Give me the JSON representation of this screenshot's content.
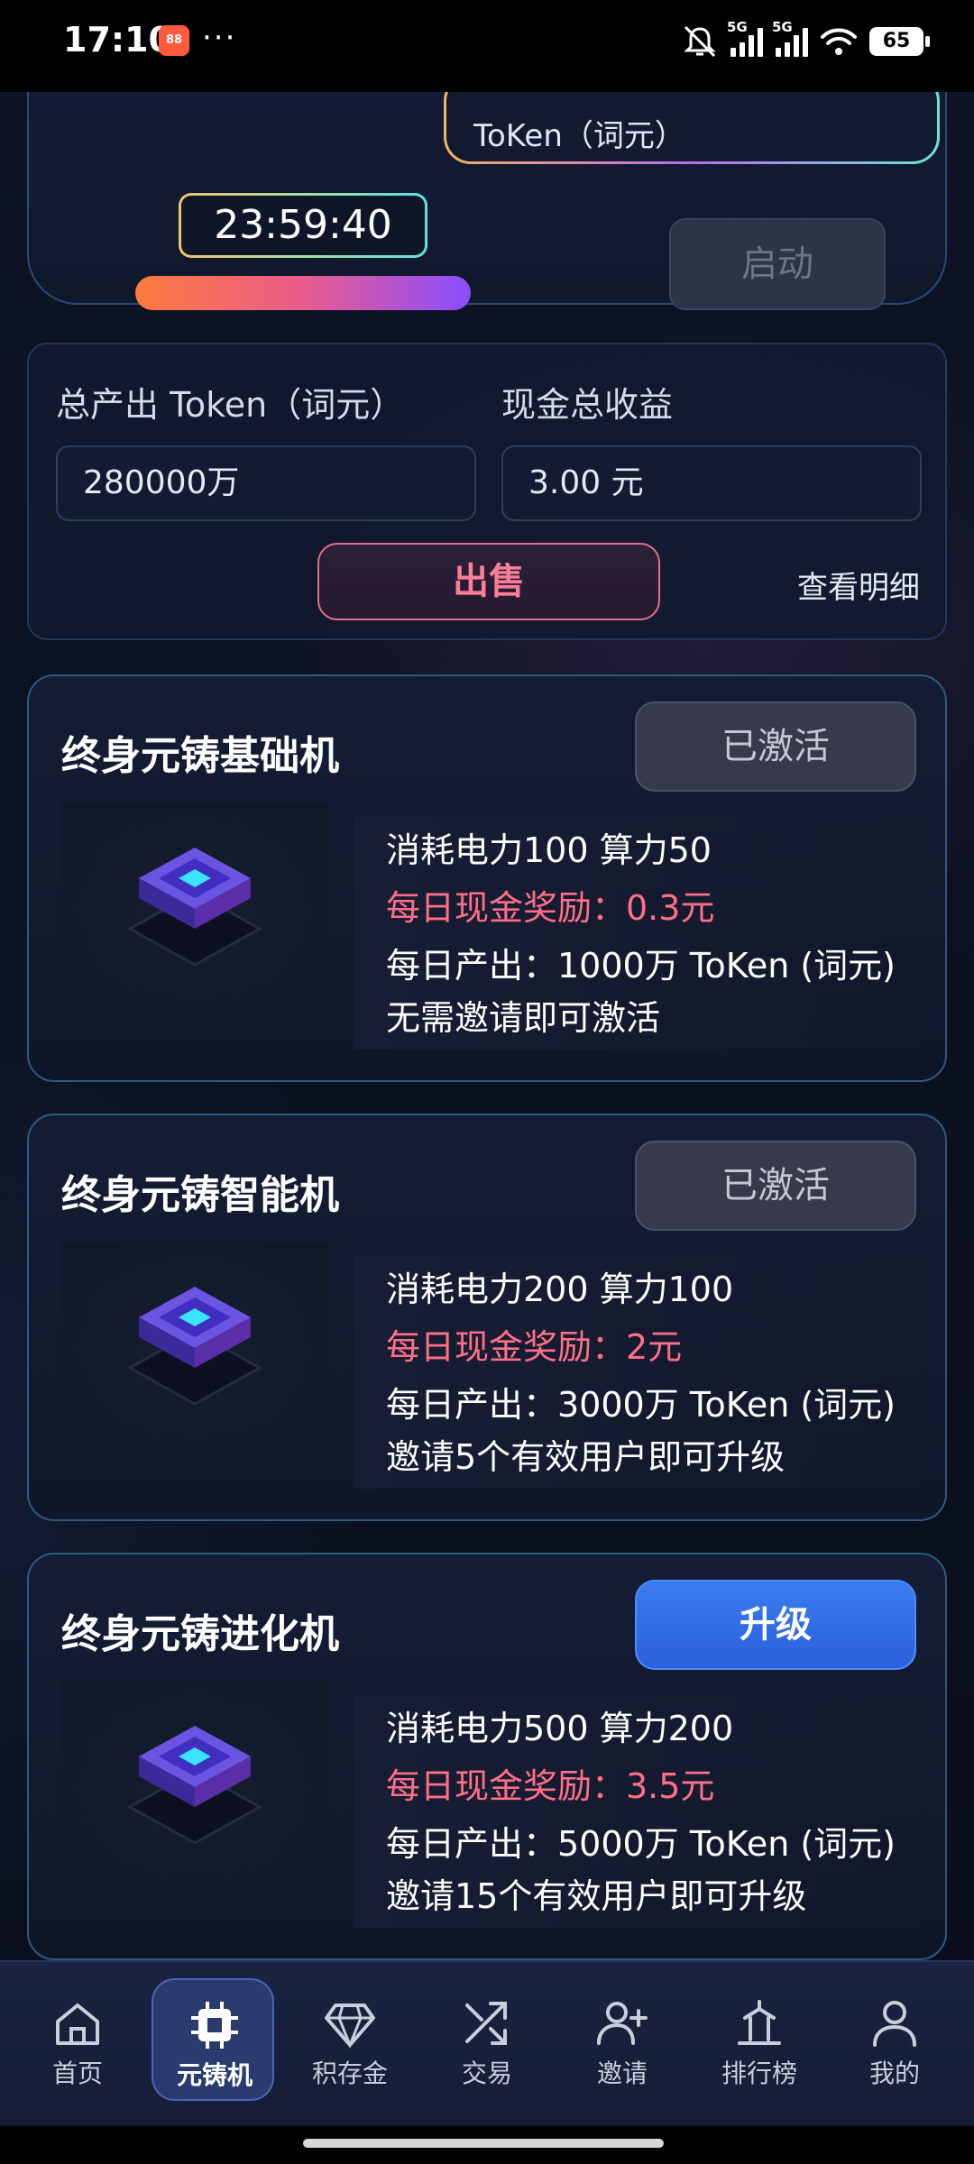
{
  "status_bar": {
    "time": "17:10",
    "app_badge": "88",
    "more": "···",
    "signal_tag_1": "5G",
    "signal_tag_2": "5G",
    "battery": "65"
  },
  "top_panel": {
    "token_label": "ToKen（词元）",
    "countdown": "23:59:40",
    "start_button": "启动"
  },
  "totals": {
    "output_label": "总产出 Token（词元）",
    "output_value": "280000万",
    "cash_label": "现金总收益",
    "cash_value": "3.00 元",
    "sell_button": "出售",
    "detail_link": "查看明细"
  },
  "machines": [
    {
      "title": "终身元铸基础机",
      "action": "已激活",
      "power": "消耗电力100 算力50",
      "reward": "每日现金奖励：0.3元",
      "output": "每日产出：1000万 ToKen (词元)",
      "condition": "无需邀请即可激活"
    },
    {
      "title": "终身元铸智能机",
      "action": "已激活",
      "power": "消耗电力200 算力100",
      "reward": "每日现金奖励：2元",
      "output": "每日产出：3000万 ToKen (词元)",
      "condition": "邀请5个有效用户即可升级"
    },
    {
      "title": "终身元铸进化机",
      "action": "升级",
      "power": "消耗电力500 算力200",
      "reward": "每日现金奖励：3.5元",
      "output": "每日产出：5000万 ToKen (词元)",
      "condition": "邀请15个有效用户即可升级"
    }
  ],
  "nav": {
    "items": [
      {
        "label": "首页",
        "icon": "home-icon"
      },
      {
        "label": "元铸机",
        "icon": "chip-icon"
      },
      {
        "label": "积存金",
        "icon": "diamond-icon"
      },
      {
        "label": "交易",
        "icon": "shuffle-icon"
      },
      {
        "label": "邀请",
        "icon": "add-user-icon"
      },
      {
        "label": "排行榜",
        "icon": "podium-icon"
      },
      {
        "label": "我的",
        "icon": "user-icon"
      }
    ],
    "active_index": 1
  },
  "colors": {
    "accent_blue": "#3a7cf0",
    "reward_pink": "#ff6f87",
    "sell_pink": "#ff7e97",
    "card_border": "#2e5a80"
  }
}
